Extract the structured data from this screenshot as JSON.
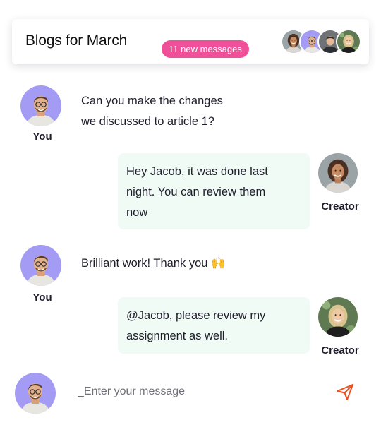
{
  "header": {
    "title": "Blogs for March",
    "badge": "11 new messages",
    "badge_color": "#f0509a",
    "participants": [
      "avatar-woman",
      "avatar-man-glasses",
      "avatar-man",
      "avatar-woman-blonde"
    ]
  },
  "messages": [
    {
      "author": "You",
      "text_line1": "Can you make the changes",
      "text_line2": "we discussed to article 1?"
    },
    {
      "author": "Creator",
      "text_line1": "Hey Jacob, it was done last",
      "text_line2": "night. You can review them",
      "text_line3": "now"
    },
    {
      "author": "You",
      "text_line1": "Brilliant work! Thank you 🙌"
    },
    {
      "author": "Creator",
      "text_line1": "@Jacob, please review my",
      "text_line2": "assignment as well."
    }
  ],
  "composer": {
    "placeholder": "_Enter your message",
    "send_icon": "send-icon",
    "send_color": "#f0501e"
  },
  "colors": {
    "bubble_bg": "#f0fbf5",
    "avatar_bg": "#a39bf4"
  }
}
